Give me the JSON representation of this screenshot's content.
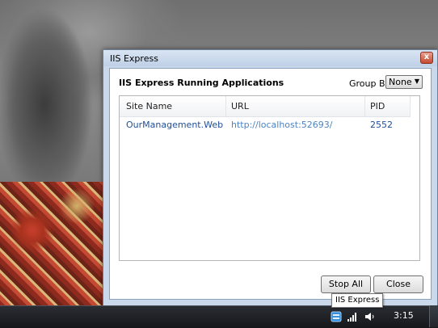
{
  "window": {
    "title": "IIS Express",
    "close_symbol": "x"
  },
  "header": {
    "heading": "IIS Express Running Applications",
    "group_by_label": "Group By",
    "group_by_value": "None"
  },
  "table": {
    "columns": [
      "Site Name",
      "URL",
      "PID"
    ],
    "rows": [
      {
        "site": "OurManagement.Web",
        "url": "http://localhost:52693/",
        "pid": "2552"
      }
    ]
  },
  "buttons": {
    "stop_all": "Stop All",
    "close": "Close"
  },
  "taskbar": {
    "tooltip": "IIS Express",
    "clock": "3:15"
  },
  "icons": [
    "iis-express-tray-icon",
    "network-signal-icon",
    "volume-icon"
  ]
}
